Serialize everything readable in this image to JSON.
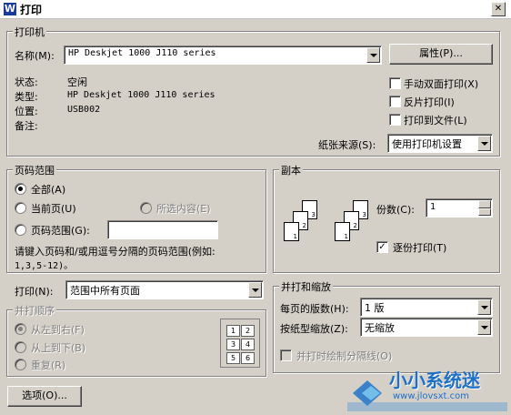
{
  "window": {
    "title": "打印",
    "icon_letter": "W",
    "close_glyph": "✕"
  },
  "printer": {
    "group_label": "打印机",
    "name_label": "名称(M):",
    "name_value": "HP Deskjet 1000 J110 series",
    "properties_button": "属性(P)...",
    "status_label": "状态:",
    "status_value": "空闲",
    "type_label": "类型:",
    "type_value": "HP Deskjet 1000 J110 series",
    "location_label": "位置:",
    "location_value": "USB002",
    "comment_label": "备注:",
    "manual_duplex": "手动双面打印(X)",
    "reverse_print": "反片打印(I)",
    "print_to_file": "打印到文件(L)",
    "paper_source_label": "纸张来源(S):",
    "paper_source_value": "使用打印机设置"
  },
  "page_range": {
    "group_label": "页码范围",
    "all": "全部(A)",
    "current": "当前页(U)",
    "selection": "所选内容(E)",
    "pages": "页码范围(G):",
    "pages_value": "",
    "hint_line1": "请键入页码和/或用逗号分隔的页码范围(例如:",
    "hint_line2": "1,3,5-12)。"
  },
  "copies": {
    "group_label": "副本",
    "count_label": "份数(C):",
    "count_value": "1",
    "collate_label": "逐份打印(T)",
    "collate_checked": true,
    "sheet_numbers": [
      "3",
      "2",
      "1",
      "3",
      "2",
      "1"
    ]
  },
  "print_what": {
    "label": "打印(N):",
    "value": "范围中所有页面"
  },
  "order": {
    "group_label": "并打顺序",
    "left_to_right": "从左到右(F)",
    "top_to_bottom": "从上到下(B)",
    "repeat": "重复(R)",
    "cells": [
      "1",
      "2",
      "3",
      "4",
      "5",
      "6"
    ]
  },
  "zoom": {
    "group_label": "并打和缩放",
    "pages_per_sheet_label": "每页的版数(H):",
    "pages_per_sheet_value": "1 版",
    "scale_label": "按纸型缩放(Z):",
    "scale_value": "无缩放",
    "draw_borders": "并打时绘制分隔线(O)"
  },
  "footer": {
    "options_button": "选项(O)..."
  },
  "watermark": {
    "text": "小小系统迷",
    "url": "www.jlovsxt.com"
  }
}
